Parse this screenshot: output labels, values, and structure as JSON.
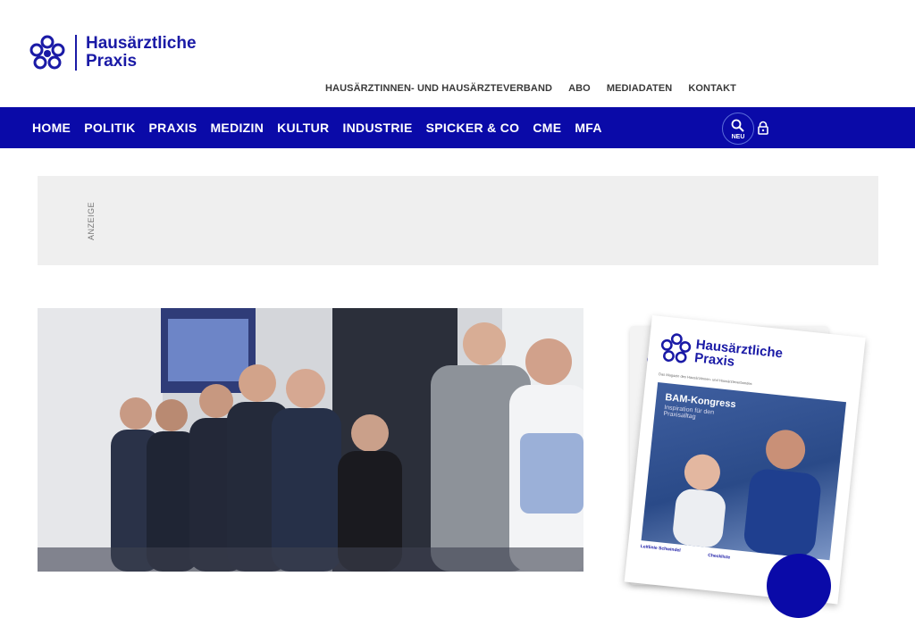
{
  "logo": {
    "line1": "Hausärztliche",
    "line2": "Praxis"
  },
  "topnav": [
    "HAUSÄRZTINNEN- UND HAUSÄRZTEVERBAND",
    "ABO",
    "MEDIADATEN",
    "KONTAKT"
  ],
  "mainnav": [
    "HOME",
    "POLITIK",
    "PRAXIS",
    "MEDIZIN",
    "KULTUR",
    "INDUSTRIE",
    "SPICKER & CO",
    "CME",
    "MFA"
  ],
  "search": {
    "badge": "NEU"
  },
  "ad": {
    "label": "ANZEIGE"
  },
  "magazine": {
    "title1": "Hausärztliche",
    "title2": "Praxis",
    "subtitle": "Das Magazin des Hausärztinnen- und Hausärzteverbandes",
    "headline": "BAM-Kongress",
    "tagline": "Inspiration für den Praxisalltag",
    "footer1": "Leitlinie Schwindel",
    "footer2": "Checkliste"
  },
  "colors": {
    "brand": "#0a0aa8",
    "adbox": "#efefef"
  }
}
